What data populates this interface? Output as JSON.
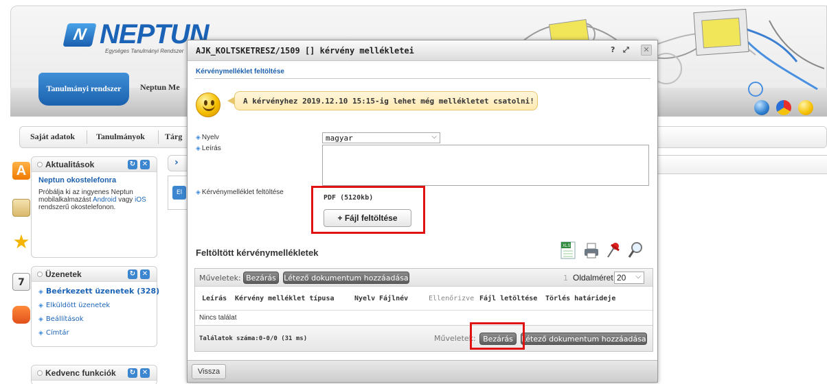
{
  "app": {
    "logo_text": "NEPTUN",
    "logo_subtitle": "Egységes Tanulmányi Rendszer",
    "tab_active": "Tanulmányi rendszer",
    "tab_next": "Neptun Me"
  },
  "menu": {
    "items": [
      "Saját adatok",
      "Tanulmányok",
      "Tárg"
    ]
  },
  "sidebar": {
    "news": {
      "title": "Aktualitások",
      "item_title": "Neptun okostelefonra",
      "text_1": "Próbálja ki az ingyenes Neptun mobilalkalmazást",
      "link_android": "Android",
      "text_2": "vagy",
      "link_ios": "iOS",
      "text_3": "rendszerű okostelefonon."
    },
    "messages": {
      "title": "Üzenetek",
      "items": [
        "Beérkezett üzenetek (328)",
        "Elküldött üzenetek",
        "Beállítások",
        "Címtár"
      ]
    },
    "favorites": {
      "title": "Kedvenc funkciók"
    },
    "calendar_day": "7"
  },
  "modal": {
    "title": "AJK_KOLTSKETRESZ/1509 [] kérvény mellékletei",
    "help": "?",
    "section_title": "Kérvénymelléklet feltöltése",
    "notice": "A kérvényhez 2019.12.10 15:15-ig lehet még mellékletet csatolni!",
    "form": {
      "language_label": "Nyelv",
      "language_value": "magyar",
      "description_label": "Leírás",
      "upload_label": "Kérvénymelléklet feltöltése",
      "file_type": "PDF (5120kb)",
      "upload_button": "+ Fájl feltöltése"
    },
    "list": {
      "title": "Feltöltött kérvénymellékletek",
      "actions_label": "Műveletek:",
      "close_button": "Bezárás",
      "add_existing_button": "Létező dokumentum hozzáadása",
      "page_number": "1",
      "page_size_label": "Oldalméret",
      "page_size": "20",
      "columns": [
        "Leírás",
        "Kérvény melléklet típusa",
        "Nyelv",
        "Fájlnév",
        "Ellenőrizve",
        "Fájl letöltése",
        "Törlés határideje"
      ],
      "empty_text": "Nincs találat",
      "count_text": "Találatok száma:0-0/0 (31 ms)",
      "footer_actions_label": "Műveletek:"
    },
    "back_button": "Vissza"
  }
}
